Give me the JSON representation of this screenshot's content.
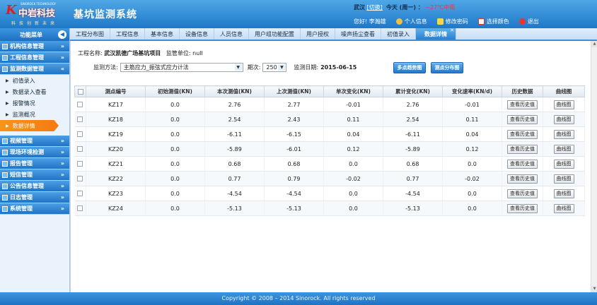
{
  "header": {
    "logo_top": "SINOROCK TECHNOLOGY",
    "logo_name": "中岩科技",
    "logo_slogan": "科技创新未来",
    "app_title": "基坑监测系统",
    "user_line": {
      "city": "武汉",
      "logout": "[切换]",
      "today_label": "今天 (周一) ：",
      "weather": "~27℃中雨"
    },
    "greeting": "您好! 李瀚雄",
    "links": [
      "个人信息",
      "修改密码",
      "选择颜色",
      "退出"
    ]
  },
  "sidebar": {
    "title": "功能菜单",
    "groups_top": [
      "机构信息管理",
      "工程信息管理",
      "监测数据管理"
    ],
    "sub_items": [
      "初值录入",
      "数据录入查看",
      "报警情况",
      "监测概况",
      "数据详情"
    ],
    "active_sub": 4,
    "groups_bottom": [
      "视频管理",
      "现场环境检测",
      "报告管理",
      "短信管理",
      "公告信息管理",
      "日志管理",
      "系统管理"
    ]
  },
  "tabs": [
    "工程分布图",
    "工程信息",
    "基本信息",
    "设备信息",
    "人员信息",
    "用户组功能配置",
    "用户授权",
    "噪声扬尘查看",
    "初值录入",
    "数据详情"
  ],
  "active_tab": 9,
  "main": {
    "project_label": "工程名称:",
    "project_name": "武汉凯德广场基坑项目",
    "unit_label": "监管单位:",
    "unit_value": "null",
    "method_label": "监测方法:",
    "method_value": "主筋应力_振弦式应力计法",
    "period_label": "期次:",
    "period_value": "250",
    "date_label": "监测日期:",
    "date_value": "2015-06-15",
    "btn_multi": "多点趋势图",
    "btn_dist": "测点分布图"
  },
  "table": {
    "headers": [
      "测点编号",
      "初始测值(KN)",
      "本次测值(KN)",
      "上次测值(KN)",
      "单次变化(KN)",
      "累计变化(KN)",
      "变化速率(KN/d)",
      "历史数据",
      "曲线图"
    ],
    "history_btn": "查看历史值",
    "curve_btn": "曲线图",
    "rows": [
      [
        "KZ17",
        "0.0",
        "2.76",
        "2.77",
        "-0.01",
        "2.76",
        "-0.01"
      ],
      [
        "KZ18",
        "0.0",
        "2.54",
        "2.43",
        "0.11",
        "2.54",
        "0.11"
      ],
      [
        "KZ19",
        "0.0",
        "-6.11",
        "-6.15",
        "0.04",
        "-6.11",
        "0.04"
      ],
      [
        "KZ20",
        "0.0",
        "-5.89",
        "-6.01",
        "0.12",
        "-5.89",
        "0.12"
      ],
      [
        "KZ21",
        "0.0",
        "0.68",
        "0.68",
        "0.0",
        "0.68",
        "0.0"
      ],
      [
        "KZ22",
        "0.0",
        "0.77",
        "0.79",
        "-0.02",
        "0.77",
        "-0.02"
      ],
      [
        "KZ23",
        "0.0",
        "-4.54",
        "-4.54",
        "0.0",
        "-4.54",
        "0.0"
      ],
      [
        "KZ24",
        "0.0",
        "-5.13",
        "-5.13",
        "0.0",
        "-5.13",
        "0.0"
      ]
    ]
  },
  "footer": "Copyright © 2008 – 2014 Sinorock. All rights reserved"
}
